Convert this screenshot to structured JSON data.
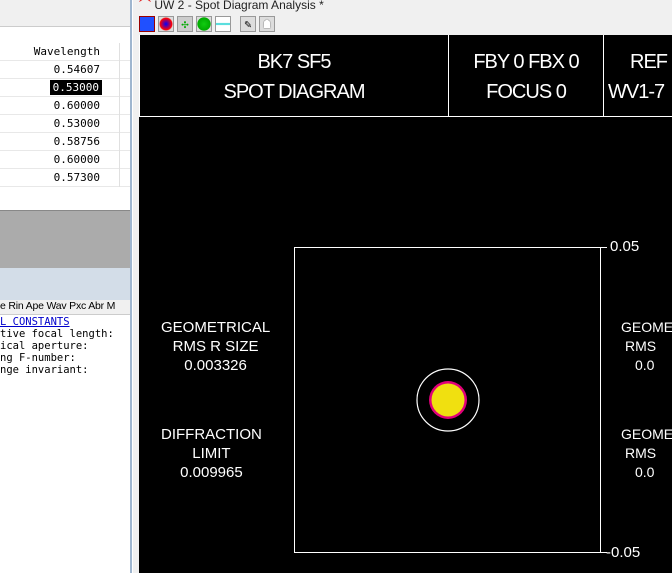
{
  "left": {
    "column_header": "Wavelength",
    "wavelengths": [
      "0.54607",
      "0.53000",
      "0.60000",
      "0.53000",
      "0.58756",
      "0.60000",
      "0.57300"
    ],
    "selected_index": 1,
    "tabs": "e Rin Ape Wav Pxc Abr M",
    "constants_link": "L CONSTANTS",
    "lines": [
      "tive focal length:",
      "ical aperture:",
      "ng F-number:",
      "nge invariant:"
    ]
  },
  "window": {
    "title": "UW 2 - Spot Diagram Analysis *",
    "toolbar": [
      "spot-grid-icon",
      "spot-pattern-icon",
      "through-focus-icon",
      "encircled-energy-icon",
      "curve-icon",
      "ghost-foot-icon",
      "ghost-icon"
    ]
  },
  "plot": {
    "header1": [
      "BK7 SF5",
      "SPOT DIAGRAM"
    ],
    "header2": [
      "FBY 0 FBX 0",
      "FOCUS 0"
    ],
    "header3": [
      "REF",
      "WV1-7"
    ],
    "geo_left": [
      "GEOMETRICAL",
      "RMS R SIZE",
      "0.003326"
    ],
    "diff_left": [
      "DIFFRACTION",
      "LIMIT",
      "0.009965"
    ],
    "geo_right1": [
      "GEOME",
      "RMS",
      "0.0"
    ],
    "geo_right2": [
      "GEOME",
      "RMS",
      "0.0"
    ],
    "scale_top": "0.05",
    "scale_bottom": "-0.05",
    "colors": {
      "spot": "#f0e010",
      "spot_edge": "#e0007a"
    }
  }
}
